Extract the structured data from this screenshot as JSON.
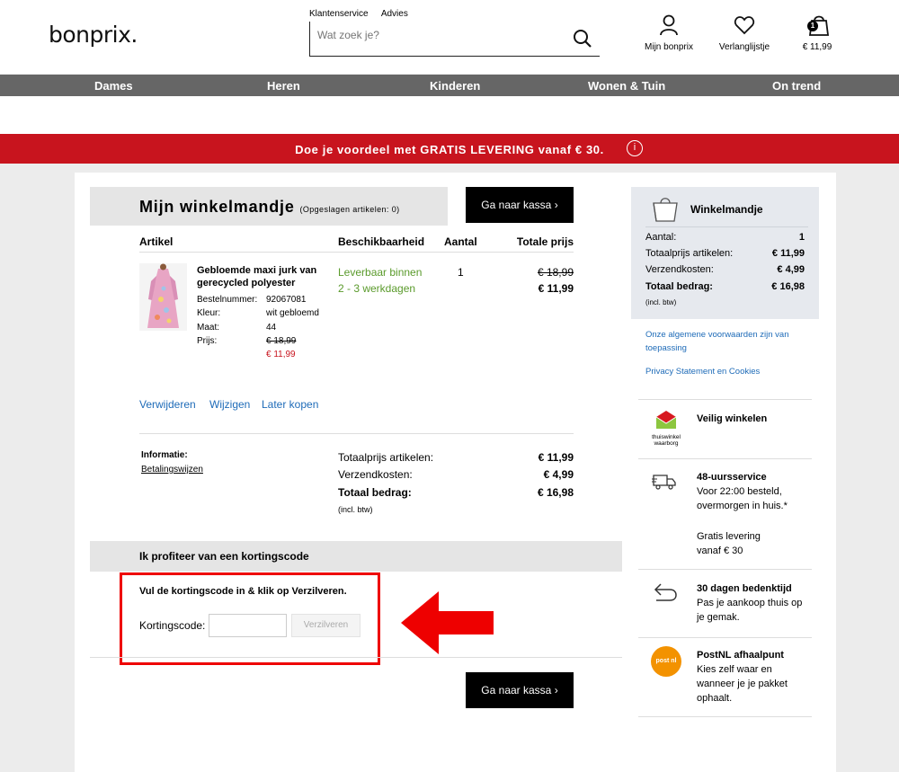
{
  "header": {
    "logo": "bonprix.",
    "top_links": [
      "Klantenservice",
      "Advies"
    ],
    "search_placeholder": "Wat zoek je?",
    "account_label": "Mijn bonprix",
    "wishlist_label": "Verlanglijstje",
    "cart_total": "€ 11,99",
    "cart_count": "1"
  },
  "nav": [
    "Dames",
    "Heren",
    "Kinderen",
    "Wonen & Tuin",
    "On trend"
  ],
  "banner": {
    "text": "Doe je voordeel met GRATIS LEVERING vanaf € 30.",
    "info_icon": "i"
  },
  "cart": {
    "title": "Mijn winkelmandje",
    "saved": "(Opgeslagen artikelen: 0)",
    "checkout_label": "Ga naar kassa",
    "columns": [
      "Artikel",
      "Beschikbaarheid",
      "Aantal",
      "Totale prijs"
    ],
    "item": {
      "name": "Gebloemde maxi jurk van gerecycled polyester",
      "order_no_label": "Bestelnummer:",
      "order_no": "92067081",
      "color_label": "Kleur:",
      "color": "wit gebloemd",
      "size_label": "Maat:",
      "size": "44",
      "price_label": "Prijs:",
      "old_price": "€ 18,99",
      "new_price": "€ 11,99",
      "availability_1": "Leverbaar binnen",
      "availability_2": "2 - 3 werkdagen",
      "quantity": "1",
      "total_old": "€ 18,99",
      "total_new": "€ 11,99"
    },
    "actions": [
      "Verwijderen",
      "Wijzigen",
      "Later kopen"
    ],
    "info_label": "Informatie:",
    "payment_link": "Betalingswijzen",
    "summary": {
      "subtotal_label": "Totaalprijs artikelen:",
      "subtotal": "€ 11,99",
      "shipping_label": "Verzendkosten:",
      "shipping": "€ 4,99",
      "total_label": "Totaal bedrag:",
      "total": "€ 16,98",
      "vat": "(incl. btw)"
    }
  },
  "coupon": {
    "title": "Ik profiteer van een kortingscode",
    "instruction": "Vul de kortingscode in & klik op Verzilveren.",
    "label": "Kortingscode:",
    "value": "",
    "button": "Verzilveren"
  },
  "sidebar": {
    "title": "Winkelmandje",
    "qty_label": "Aantal:",
    "qty": "1",
    "subtotal_label": "Totaalprijs artikelen:",
    "subtotal": "€ 11,99",
    "shipping_label": "Verzendkosten:",
    "shipping": "€ 4,99",
    "total_label": "Totaal bedrag:",
    "total": "€ 16,98",
    "vat": "(incl. btw)",
    "terms_link": "Onze algemene voorwaarden zijn van toepassing",
    "privacy_link": "Privacy Statement en Cookies",
    "thuiswinkel_1": "thuiswinkel",
    "thuiswinkel_2": "waarborg",
    "features": [
      {
        "title": "Veilig winkelen",
        "text": ""
      },
      {
        "title": "48-uursservice",
        "text": "Voor 22:00 besteld, overmorgen in huis.*"
      },
      {
        "title": "",
        "text": "Gratis levering vanaf € 30"
      },
      {
        "title": "30 dagen bedenktijd",
        "text": "Pas je aankoop thuis op je gemak."
      },
      {
        "title": "PostNL afhaalpunt",
        "text": "Kies zelf waar en wanneer je je pakket ophaalt."
      }
    ],
    "postnl_badge": "post nl"
  },
  "colors": {
    "brand_red": "#c8141e",
    "nav_grey": "#666666",
    "link_blue": "#1e6bb8",
    "availability_green": "#5a9a2b",
    "annotation_red": "#ee0000"
  }
}
